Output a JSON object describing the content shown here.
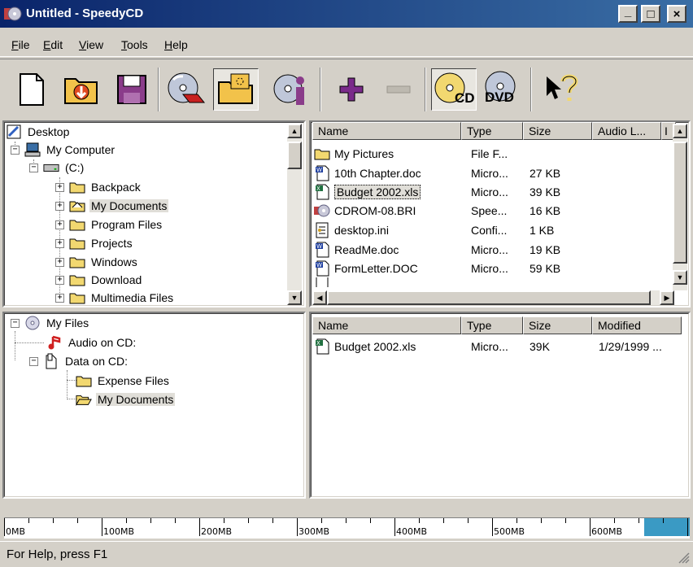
{
  "window": {
    "title": "Untitled - SpeedyCD",
    "minimize": "_",
    "maximize": "□",
    "close": "×"
  },
  "menu": [
    {
      "label": "File",
      "key": "F",
      "rest": "ile"
    },
    {
      "label": "Edit",
      "key": "E",
      "rest": "dit"
    },
    {
      "label": "View",
      "key": "V",
      "rest": "iew"
    },
    {
      "label": "Tools",
      "key": "T",
      "rest": "ools"
    },
    {
      "label": "Help",
      "key": "H",
      "rest": "elp"
    }
  ],
  "toolbar": {
    "buttons": [
      "new",
      "open",
      "save",
      "burn",
      "add-folder",
      "disc-info",
      "add",
      "remove",
      "cd",
      "dvd",
      "whats-this"
    ],
    "cd_label": "CD",
    "dvd_label": "DVD"
  },
  "source_tree": {
    "desktop": "Desktop",
    "my_computer": "My Computer",
    "drive": "(C:)",
    "folders": [
      "Backpack",
      "My Documents",
      "Program Files",
      "Projects",
      "Windows",
      "Download",
      "Multimedia Files"
    ]
  },
  "source_list": {
    "columns": [
      "Name",
      "Type",
      "Size",
      "Audio L...",
      "I"
    ],
    "rows": [
      {
        "name": "My Pictures",
        "type": "File F...",
        "size": ""
      },
      {
        "name": "10th Chapter.doc",
        "type": "Micro...",
        "size": "27 KB"
      },
      {
        "name": "Budget 2002.xls",
        "type": "Micro...",
        "size": "39 KB"
      },
      {
        "name": "CDROM-08.BRI",
        "type": "Spee...",
        "size": "16 KB"
      },
      {
        "name": "desktop.ini",
        "type": "Confi...",
        "size": "1 KB"
      },
      {
        "name": "ReadMe.doc",
        "type": "Micro...",
        "size": "19 KB"
      },
      {
        "name": "FormLetter.DOC",
        "type": "Micro...",
        "size": "59 KB"
      }
    ]
  },
  "disc_tree": {
    "root": "My Files",
    "audio": "Audio on CD:",
    "data": "Data on CD:",
    "folders": [
      "Expense Files",
      "My Documents"
    ]
  },
  "disc_list": {
    "columns": [
      "Name",
      "Type",
      "Size",
      "Modified"
    ],
    "rows": [
      {
        "name": "Budget 2002.xls",
        "type": "Micro...",
        "size": "39K",
        "modified": "1/29/1999 ..."
      }
    ]
  },
  "capacity": {
    "labels": [
      "0MB",
      "100MB",
      "200MB",
      "300MB",
      "400MB",
      "500MB",
      "600MB"
    ],
    "max_mb": 700,
    "fill_start_mb": 656,
    "fill_color": "#3a9ac4"
  },
  "status": {
    "text": "For Help, press F1"
  }
}
